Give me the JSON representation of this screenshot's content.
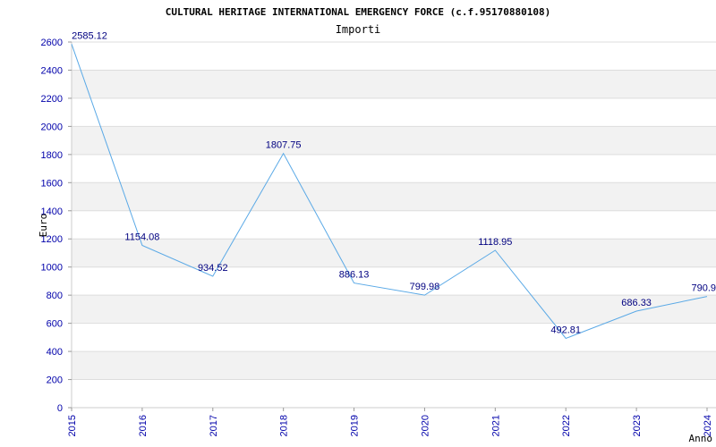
{
  "chart_data": {
    "type": "line",
    "title": "CULTURAL HERITAGE INTERNATIONAL EMERGENCY FORCE (c.f.95170880108)",
    "subtitle": "Importi",
    "xlabel": "Anno",
    "ylabel": "Euro",
    "x": [
      "2015",
      "2016",
      "2017",
      "2018",
      "2019",
      "2020",
      "2021",
      "2022",
      "2023",
      "2024"
    ],
    "values": [
      2585.12,
      1154.08,
      934.52,
      1807.75,
      886.13,
      799.98,
      1118.95,
      492.81,
      686.33,
      790.9
    ],
    "value_labels": [
      "2585.12",
      "1154.08",
      "934.52",
      "1807.75",
      "886.13",
      "799.98",
      "1118.95",
      "492.81",
      "686.33",
      "790.9"
    ],
    "yticks": [
      "0",
      "200",
      "400",
      "600",
      "800",
      "1000",
      "1200",
      "1400",
      "1600",
      "1800",
      "2000",
      "2200",
      "2400",
      "2600"
    ],
    "ylim": [
      0,
      2600
    ],
    "grid": true,
    "line_color": "#5aa9e6",
    "band_color": "#f2f2f2",
    "tick_color": "#0000aa",
    "label_color": "#000080"
  }
}
